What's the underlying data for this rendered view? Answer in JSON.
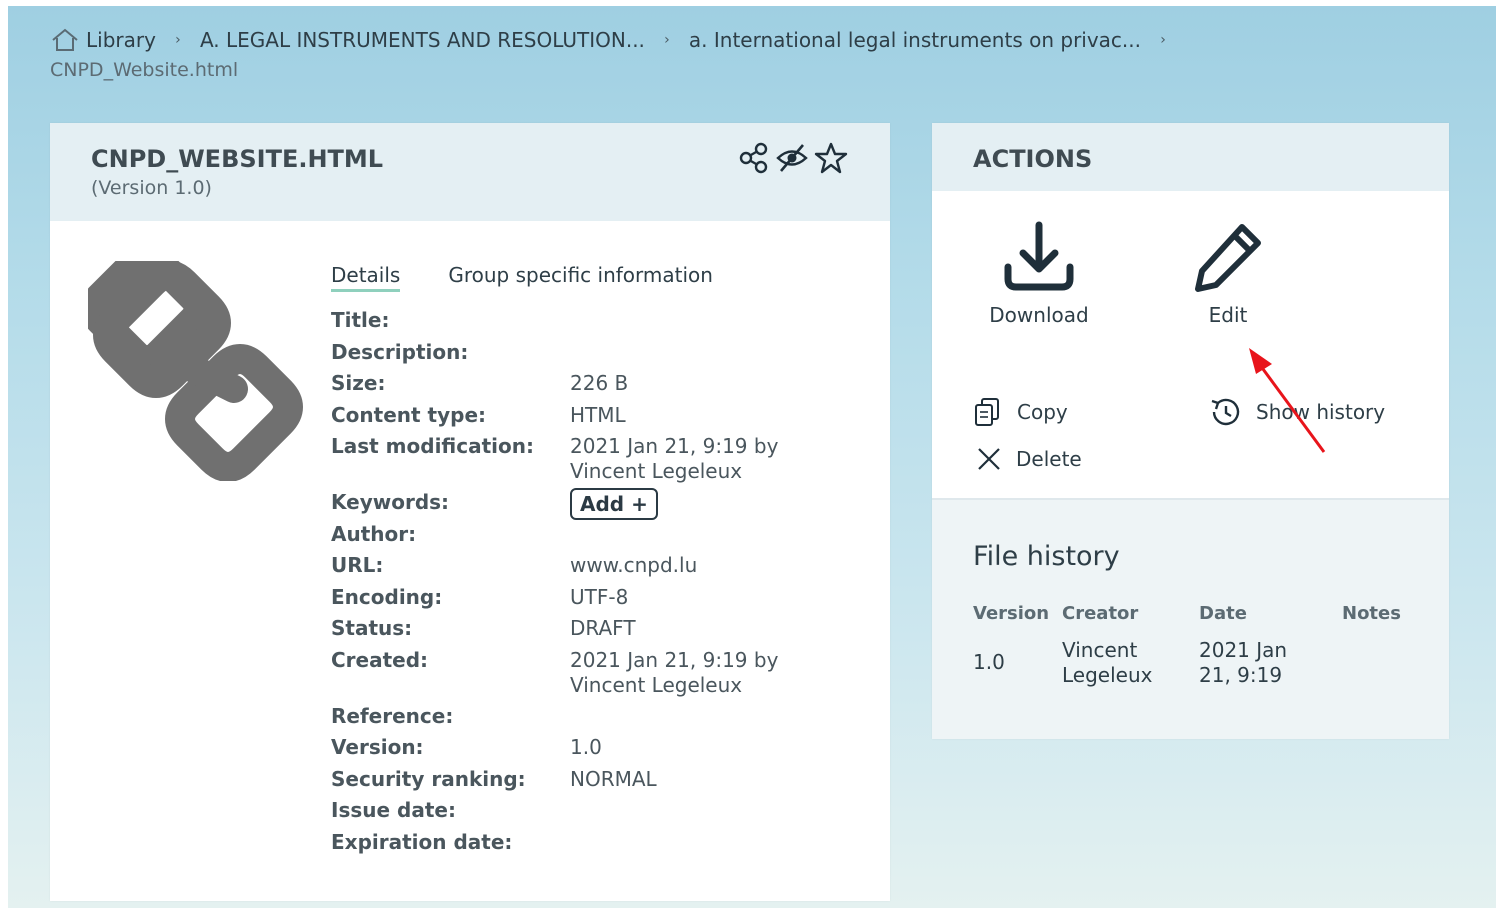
{
  "breadcrumb": {
    "items": [
      {
        "label": "Library",
        "icon": "home-icon"
      },
      {
        "label": "A. LEGAL INSTRUMENTS AND RESOLUTION..."
      },
      {
        "label": "a. International legal instruments on privac..."
      }
    ],
    "current": "CNPD_Website.html"
  },
  "file": {
    "title": "CNPD_WEBSITE.HTML",
    "version": "(Version 1.0)",
    "icons": [
      "share-icon",
      "hide-icon",
      "star-icon"
    ]
  },
  "tabs": {
    "details": "Details",
    "group": "Group specific information"
  },
  "details": {
    "title_label": "Title:",
    "description_label": "Description:",
    "size_label": "Size:",
    "size_value": "226 B",
    "content_type_label": "Content type:",
    "content_type_value": "HTML",
    "last_mod_label": "Last modification:",
    "last_mod_value_1": "2021 Jan 21, 9:19 by",
    "last_mod_value_2": "Vincent Legeleux",
    "keywords_label": "Keywords:",
    "keywords_add": "Add +",
    "author_label": "Author:",
    "url_label": "URL:",
    "url_value": "www.cnpd.lu",
    "encoding_label": "Encoding:",
    "encoding_value": "UTF-8",
    "status_label": "Status:",
    "status_value": "DRAFT",
    "created_label": "Created:",
    "created_value_1": "2021 Jan 21, 9:19 by",
    "created_value_2": "Vincent Legeleux",
    "reference_label": "Reference:",
    "version_label": "Version:",
    "version_value": "1.0",
    "security_label": "Security ranking:",
    "security_value": "NORMAL",
    "issue_label": "Issue date:",
    "expiration_label": "Expiration date:"
  },
  "actions": {
    "heading": "ACTIONS",
    "download": "Download",
    "edit": "Edit",
    "copy": "Copy",
    "show_history": "Show history",
    "delete": "Delete"
  },
  "history": {
    "title": "File history",
    "headers": {
      "version": "Version",
      "creator": "Creator",
      "date": "Date",
      "notes": "Notes"
    },
    "rows": [
      {
        "version": "1.0",
        "creator_1": "Vincent",
        "creator_2": "Legeleux",
        "date_1": "2021 Jan",
        "date_2": "21, 9:19",
        "notes": ""
      }
    ]
  },
  "colors": {
    "arrow": "#e8141b",
    "tab_underline": "#8fd0bd",
    "icon_dark": "#1f2f3a",
    "link_icon": "#707070"
  }
}
